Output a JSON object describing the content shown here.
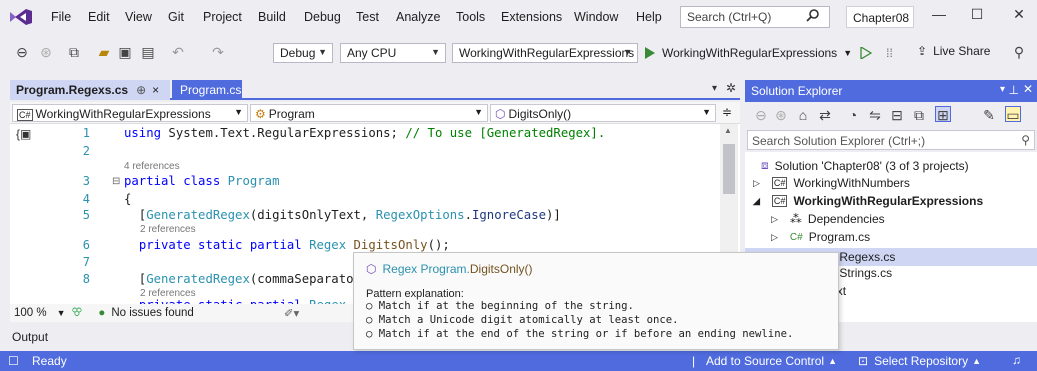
{
  "menubar": {
    "items": [
      "File",
      "Edit",
      "View",
      "Git",
      "Project",
      "Build",
      "Debug",
      "Test",
      "Analyze",
      "Tools",
      "Extensions",
      "Window",
      "Help"
    ],
    "search_placeholder": "Search (Ctrl+Q)",
    "solution_name": "Chapter08"
  },
  "toolbar": {
    "config": "Debug",
    "platform": "Any CPU",
    "startup_project": "WorkingWithRegularExpressions",
    "run_label": "WorkingWithRegularExpressions",
    "live_share": "Live Share"
  },
  "editor": {
    "tabs": [
      {
        "label": "Program.Regexs.cs",
        "pin": "⊕",
        "close": "×"
      },
      {
        "label": "Program.cs"
      }
    ],
    "nav": {
      "project": "WorkingWithRegularExpressions",
      "class": "Program",
      "member": "DigitsOnly()"
    },
    "lines": {
      "n1": "1",
      "n2": "2",
      "n3": "3",
      "n4": "4",
      "n5": "5",
      "n6": "6",
      "n7": "7",
      "n8": "8"
    },
    "refs": {
      "r4": "4 references",
      "r2a": "2 references",
      "r2b": "2 references"
    },
    "zoom": "100 %",
    "issues": "No issues found"
  },
  "output": {
    "label": "Output"
  },
  "statusbar": {
    "ready": "Ready",
    "source_control": "Add to Source Control",
    "repo": "Select Repository"
  },
  "solution_explorer": {
    "title": "Solution Explorer",
    "search_placeholder": "Search Solution Explorer (Ctrl+;)",
    "items": [
      {
        "label": "Solution 'Chapter08' (3 of 3 projects)"
      },
      {
        "label": "WorkingWithNumbers"
      },
      {
        "label": "WorkingWithRegularExpressions"
      },
      {
        "label": "Dependencies"
      },
      {
        "label": "Program.cs"
      },
      {
        "label": "gram.Regexs.cs"
      },
      {
        "label": "gram.Strings.cs"
      },
      {
        "label": "gWithText"
      }
    ]
  },
  "tooltip": {
    "signature_a": "Regex Program.",
    "signature_b": "DigitsOnly()",
    "explanation": "Pattern explanation:",
    "lines": [
      "○ Match if at the beginning of the string.",
      "○ Match a Unicode digit atomically at least once.",
      "○ Match if at the end of the string or if before an ending newline."
    ]
  },
  "colors": {
    "accent": "#4f6bde",
    "chrome": "#eeeef2",
    "keyword": "#0000ff",
    "type": "#2b91af",
    "comment": "#008000"
  }
}
